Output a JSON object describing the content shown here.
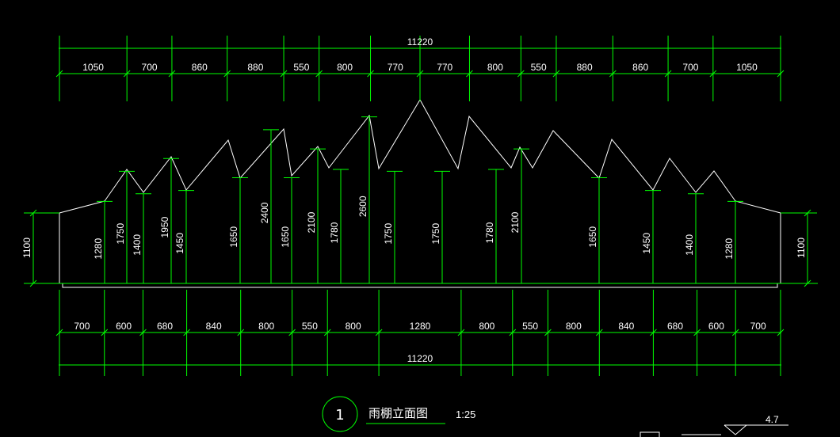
{
  "drawing": {
    "background": "#000000",
    "dim_color": "#00ff00",
    "outline_color": "#ffffff",
    "total_length": "11220",
    "top_segments": [
      "1050",
      "700",
      "860",
      "880",
      "550",
      "800",
      "770",
      "770",
      "800",
      "550",
      "880",
      "860",
      "700",
      "1050"
    ],
    "bottom_segments": [
      "700",
      "600",
      "680",
      "840",
      "800",
      "550",
      "800",
      "1280",
      "800",
      "550",
      "800",
      "840",
      "680",
      "600",
      "700"
    ],
    "side_height": "1100",
    "heights": [
      "1280",
      "1750",
      "1400",
      "1950",
      "1450",
      "1650",
      "2400",
      "1650",
      "2100",
      "1780",
      "2600",
      "1750",
      "1750",
      "1780",
      "2100",
      "1650",
      "1450",
      "1400",
      "1280"
    ],
    "title_number": "1",
    "title": "雨棚立面图",
    "scale": "1:25",
    "level_mark": "4.7"
  }
}
